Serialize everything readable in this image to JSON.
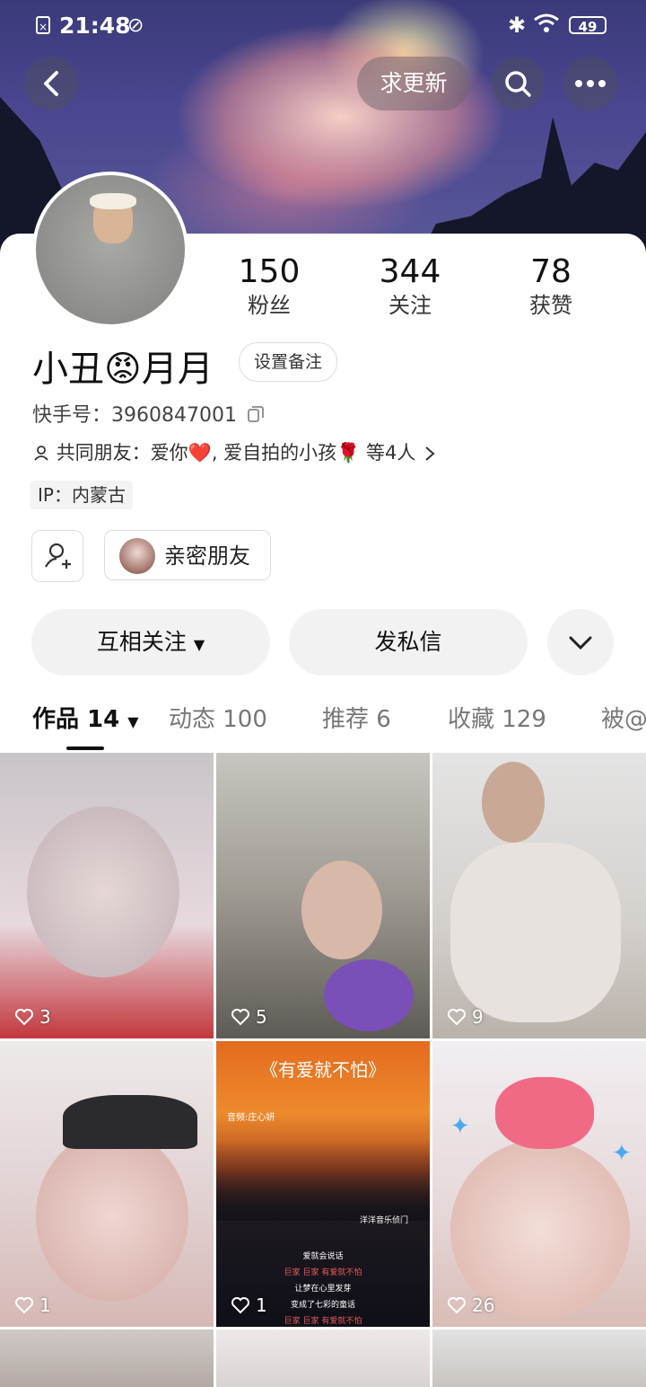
{
  "status_bar": {
    "time": "21:48",
    "battery": "49"
  },
  "header": {
    "update_label": "求更新"
  },
  "profile": {
    "name": "小丑😡月月",
    "set_remark": "设置备注",
    "kuaishou_id": "快手号：3960847001",
    "mutual_friends": "共同朋友：爱你❤️, 爱自拍的小孩🌹 等4人",
    "ip": "IP：内蒙古",
    "close_friend": "亲密朋友"
  },
  "stats": [
    {
      "value": "150",
      "label": "粉丝"
    },
    {
      "value": "344",
      "label": "关注"
    },
    {
      "value": "78",
      "label": "获赞"
    }
  ],
  "actions": {
    "follow": "互相关注",
    "message": "发私信"
  },
  "tabs": [
    {
      "label": "作品 14"
    },
    {
      "label": "动态 100"
    },
    {
      "label": "推荐 6"
    },
    {
      "label": "收藏 129"
    },
    {
      "label": "被@"
    }
  ],
  "videos": [
    {
      "likes": "3"
    },
    {
      "likes": "5"
    },
    {
      "likes": "9"
    },
    {
      "likes": "1",
      "title": ""
    },
    {
      "likes": "1",
      "title": "《有爱就不怕》",
      "subtitle": "音频:庄心妍",
      "lines": [
        "爱就会说话",
        "巨家 巨家 有爱就不怕",
        "让梦在心里发芽",
        "变成了七彩的童话",
        "巨家 巨家 有爱就不怕"
      ],
      "watermark": "洋洋音乐侦门"
    },
    {
      "likes": "26"
    }
  ],
  "colors": {
    "accent": "#111111",
    "pill_bg": "#f2f2f2",
    "cover_sky": "#4a4690"
  }
}
